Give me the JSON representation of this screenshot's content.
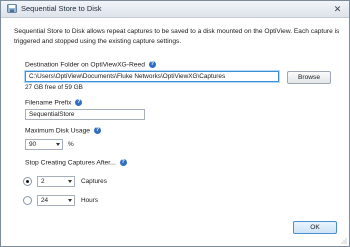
{
  "window": {
    "title": "Sequential Store to Disk",
    "close_glyph": "✕"
  },
  "description": "Sequential Store to Disk allows repeat captures to be saved to a disk mounted on the OptiView. Each capture is triggered and stopped using the existing capture settings.",
  "destination": {
    "label": "Destination Folder on OptiViewXG-Reed",
    "path": "C:\\Users\\OptiView\\Documents\\Fluke Networks\\OptiViewXG\\Captures",
    "free_space": "27 GB free of 59 GB",
    "browse_label": "Browse"
  },
  "filename_prefix": {
    "label": "Filename Prefix",
    "value": "SequentialStore"
  },
  "max_disk_usage": {
    "label": "Maximum Disk Usage",
    "value": "90",
    "unit": "%"
  },
  "stop_after": {
    "label": "Stop Creating Captures After...",
    "captures_value": "2",
    "captures_unit": "Captures",
    "hours_value": "24",
    "hours_unit": "Hours",
    "selected": "captures"
  },
  "help_glyph": "?",
  "ok_label": "OK",
  "colors": {
    "accent": "#2f6fc1",
    "focus_border": "#3c8fd6"
  }
}
